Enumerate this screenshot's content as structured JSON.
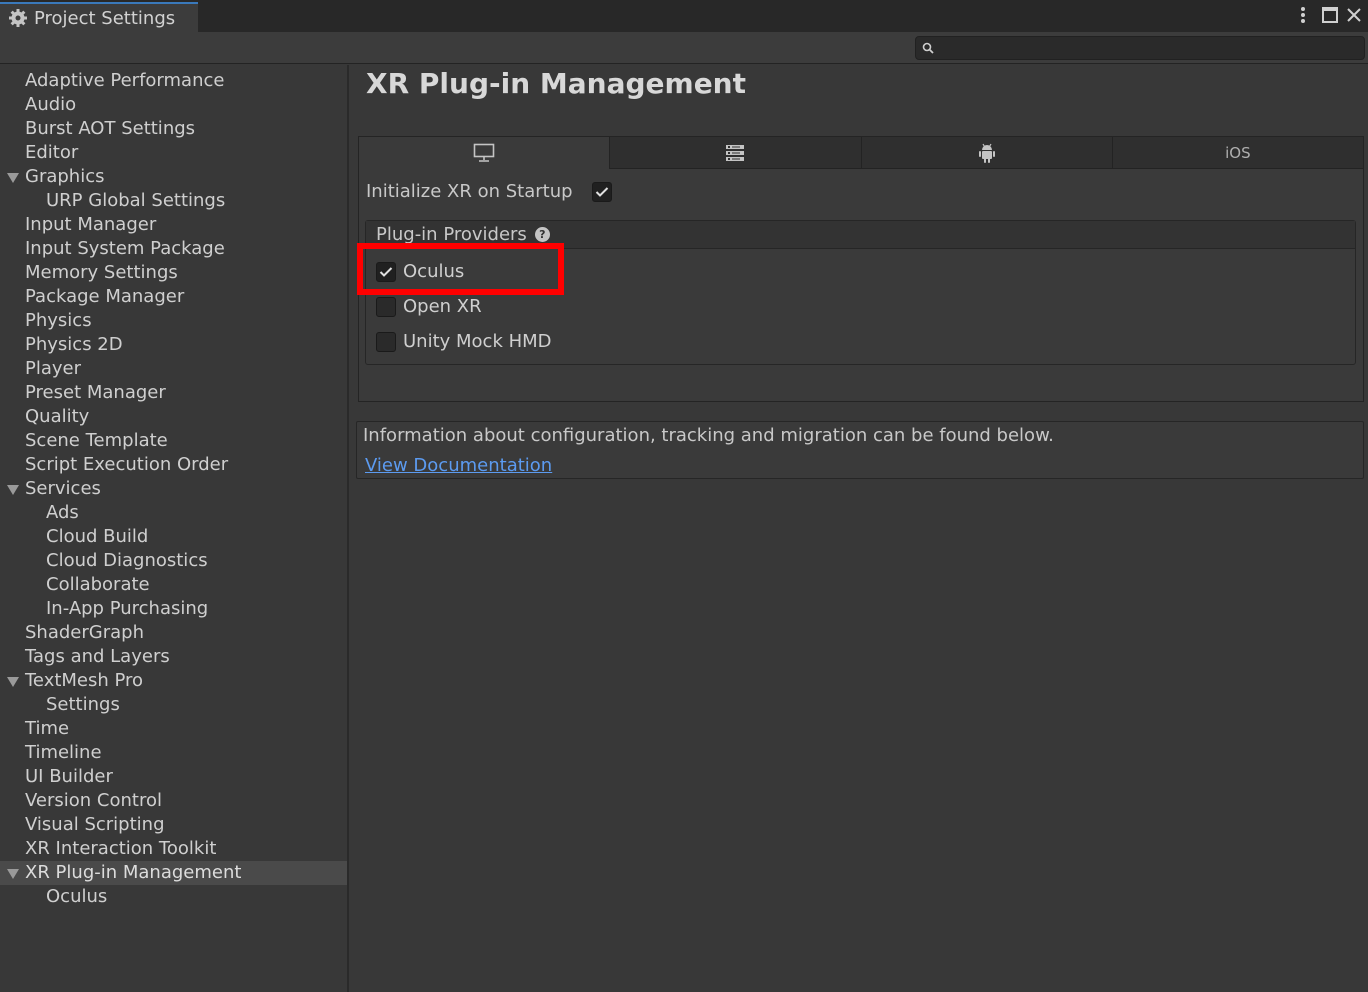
{
  "window": {
    "tab_title": "Project Settings",
    "tab_icon": "gear-icon",
    "controls": [
      "more-options-icon",
      "maximize-icon",
      "close-icon"
    ]
  },
  "search": {
    "placeholder": "",
    "value": ""
  },
  "sidebar": {
    "items": [
      {
        "label": "Adaptive Performance",
        "level": 0
      },
      {
        "label": "Audio",
        "level": 0
      },
      {
        "label": "Burst AOT Settings",
        "level": 0
      },
      {
        "label": "Editor",
        "level": 0
      },
      {
        "label": "Graphics",
        "level": 0,
        "expanded": true
      },
      {
        "label": "URP Global Settings",
        "level": 1
      },
      {
        "label": "Input Manager",
        "level": 0
      },
      {
        "label": "Input System Package",
        "level": 0
      },
      {
        "label": "Memory Settings",
        "level": 0
      },
      {
        "label": "Package Manager",
        "level": 0
      },
      {
        "label": "Physics",
        "level": 0
      },
      {
        "label": "Physics 2D",
        "level": 0
      },
      {
        "label": "Player",
        "level": 0
      },
      {
        "label": "Preset Manager",
        "level": 0
      },
      {
        "label": "Quality",
        "level": 0
      },
      {
        "label": "Scene Template",
        "level": 0
      },
      {
        "label": "Script Execution Order",
        "level": 0
      },
      {
        "label": "Services",
        "level": 0,
        "expanded": true
      },
      {
        "label": "Ads",
        "level": 1
      },
      {
        "label": "Cloud Build",
        "level": 1
      },
      {
        "label": "Cloud Diagnostics",
        "level": 1
      },
      {
        "label": "Collaborate",
        "level": 1
      },
      {
        "label": "In-App Purchasing",
        "level": 1
      },
      {
        "label": "ShaderGraph",
        "level": 0
      },
      {
        "label": "Tags and Layers",
        "level": 0
      },
      {
        "label": "TextMesh Pro",
        "level": 0,
        "expanded": true
      },
      {
        "label": "Settings",
        "level": 1
      },
      {
        "label": "Time",
        "level": 0
      },
      {
        "label": "Timeline",
        "level": 0
      },
      {
        "label": "UI Builder",
        "level": 0
      },
      {
        "label": "Version Control",
        "level": 0
      },
      {
        "label": "Visual Scripting",
        "level": 0
      },
      {
        "label": "XR Interaction Toolkit",
        "level": 0
      },
      {
        "label": "XR Plug-in Management",
        "level": 0,
        "expanded": true,
        "selected": true
      },
      {
        "label": "Oculus",
        "level": 1
      }
    ]
  },
  "main": {
    "title": "XR Plug-in Management",
    "platform_tabs": [
      {
        "icon": "monitor-icon",
        "label": "",
        "active": true
      },
      {
        "icon": "server-icon",
        "label": ""
      },
      {
        "icon": "android-icon",
        "label": ""
      },
      {
        "icon": "",
        "label": "iOS"
      }
    ],
    "init_on_startup_label": "Initialize XR on Startup",
    "init_on_startup_checked": true,
    "providers_header": "Plug-in Providers",
    "providers": [
      {
        "label": "Oculus",
        "checked": true,
        "highlighted": true
      },
      {
        "label": "Open XR",
        "checked": false
      },
      {
        "label": "Unity Mock HMD",
        "checked": false
      }
    ],
    "info_text": "Information about configuration, tracking and migration can be found below.",
    "doc_link": "View Documentation"
  },
  "colors": {
    "highlight": "#ff0000",
    "link": "#5c9bf0",
    "tab_accent": "#3a79bb"
  }
}
